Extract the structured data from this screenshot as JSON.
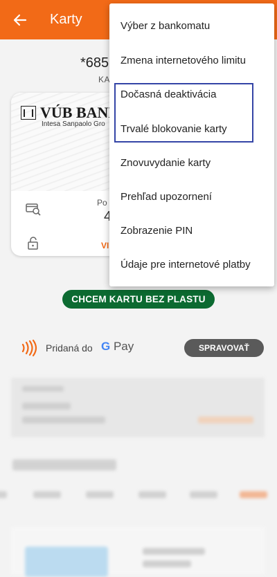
{
  "appbar": {
    "title": "Karty",
    "back_icon": "arrow-left-icon",
    "bg_color": "#f26a17"
  },
  "card_header": {
    "number": "*685",
    "subtitle": "KA"
  },
  "card": {
    "bank_name": "VÚB BANK",
    "bank_sub": "Intesa Sanpaolo Gro",
    "rows": [
      {
        "icon": "card-search-icon",
        "label": "Po",
        "value": "4"
      },
      {
        "icon": "lock-icon",
        "link": "VI"
      }
    ]
  },
  "plasticless_button": "CHCEM KARTU BEZ PLASTU",
  "gpay": {
    "text": "Pridaná do",
    "brand_g": "G",
    "brand_pay": "Pay",
    "manage_label": "SPRAVOVAŤ"
  },
  "menu": {
    "items": [
      "Výber z bankomatu",
      "Zmena internetového limitu",
      "Dočasná deaktivácia",
      "Trvalé blokovanie karty",
      "Znovuvydanie karty",
      "Prehľad upozornení",
      "Zobrazenie PIN",
      "Údaje pre internetové platby"
    ],
    "highlight_color": "#3344a6"
  },
  "colors": {
    "accent": "#f26a17",
    "green": "#0c6a31",
    "manage_bg": "#5a5a5a"
  }
}
